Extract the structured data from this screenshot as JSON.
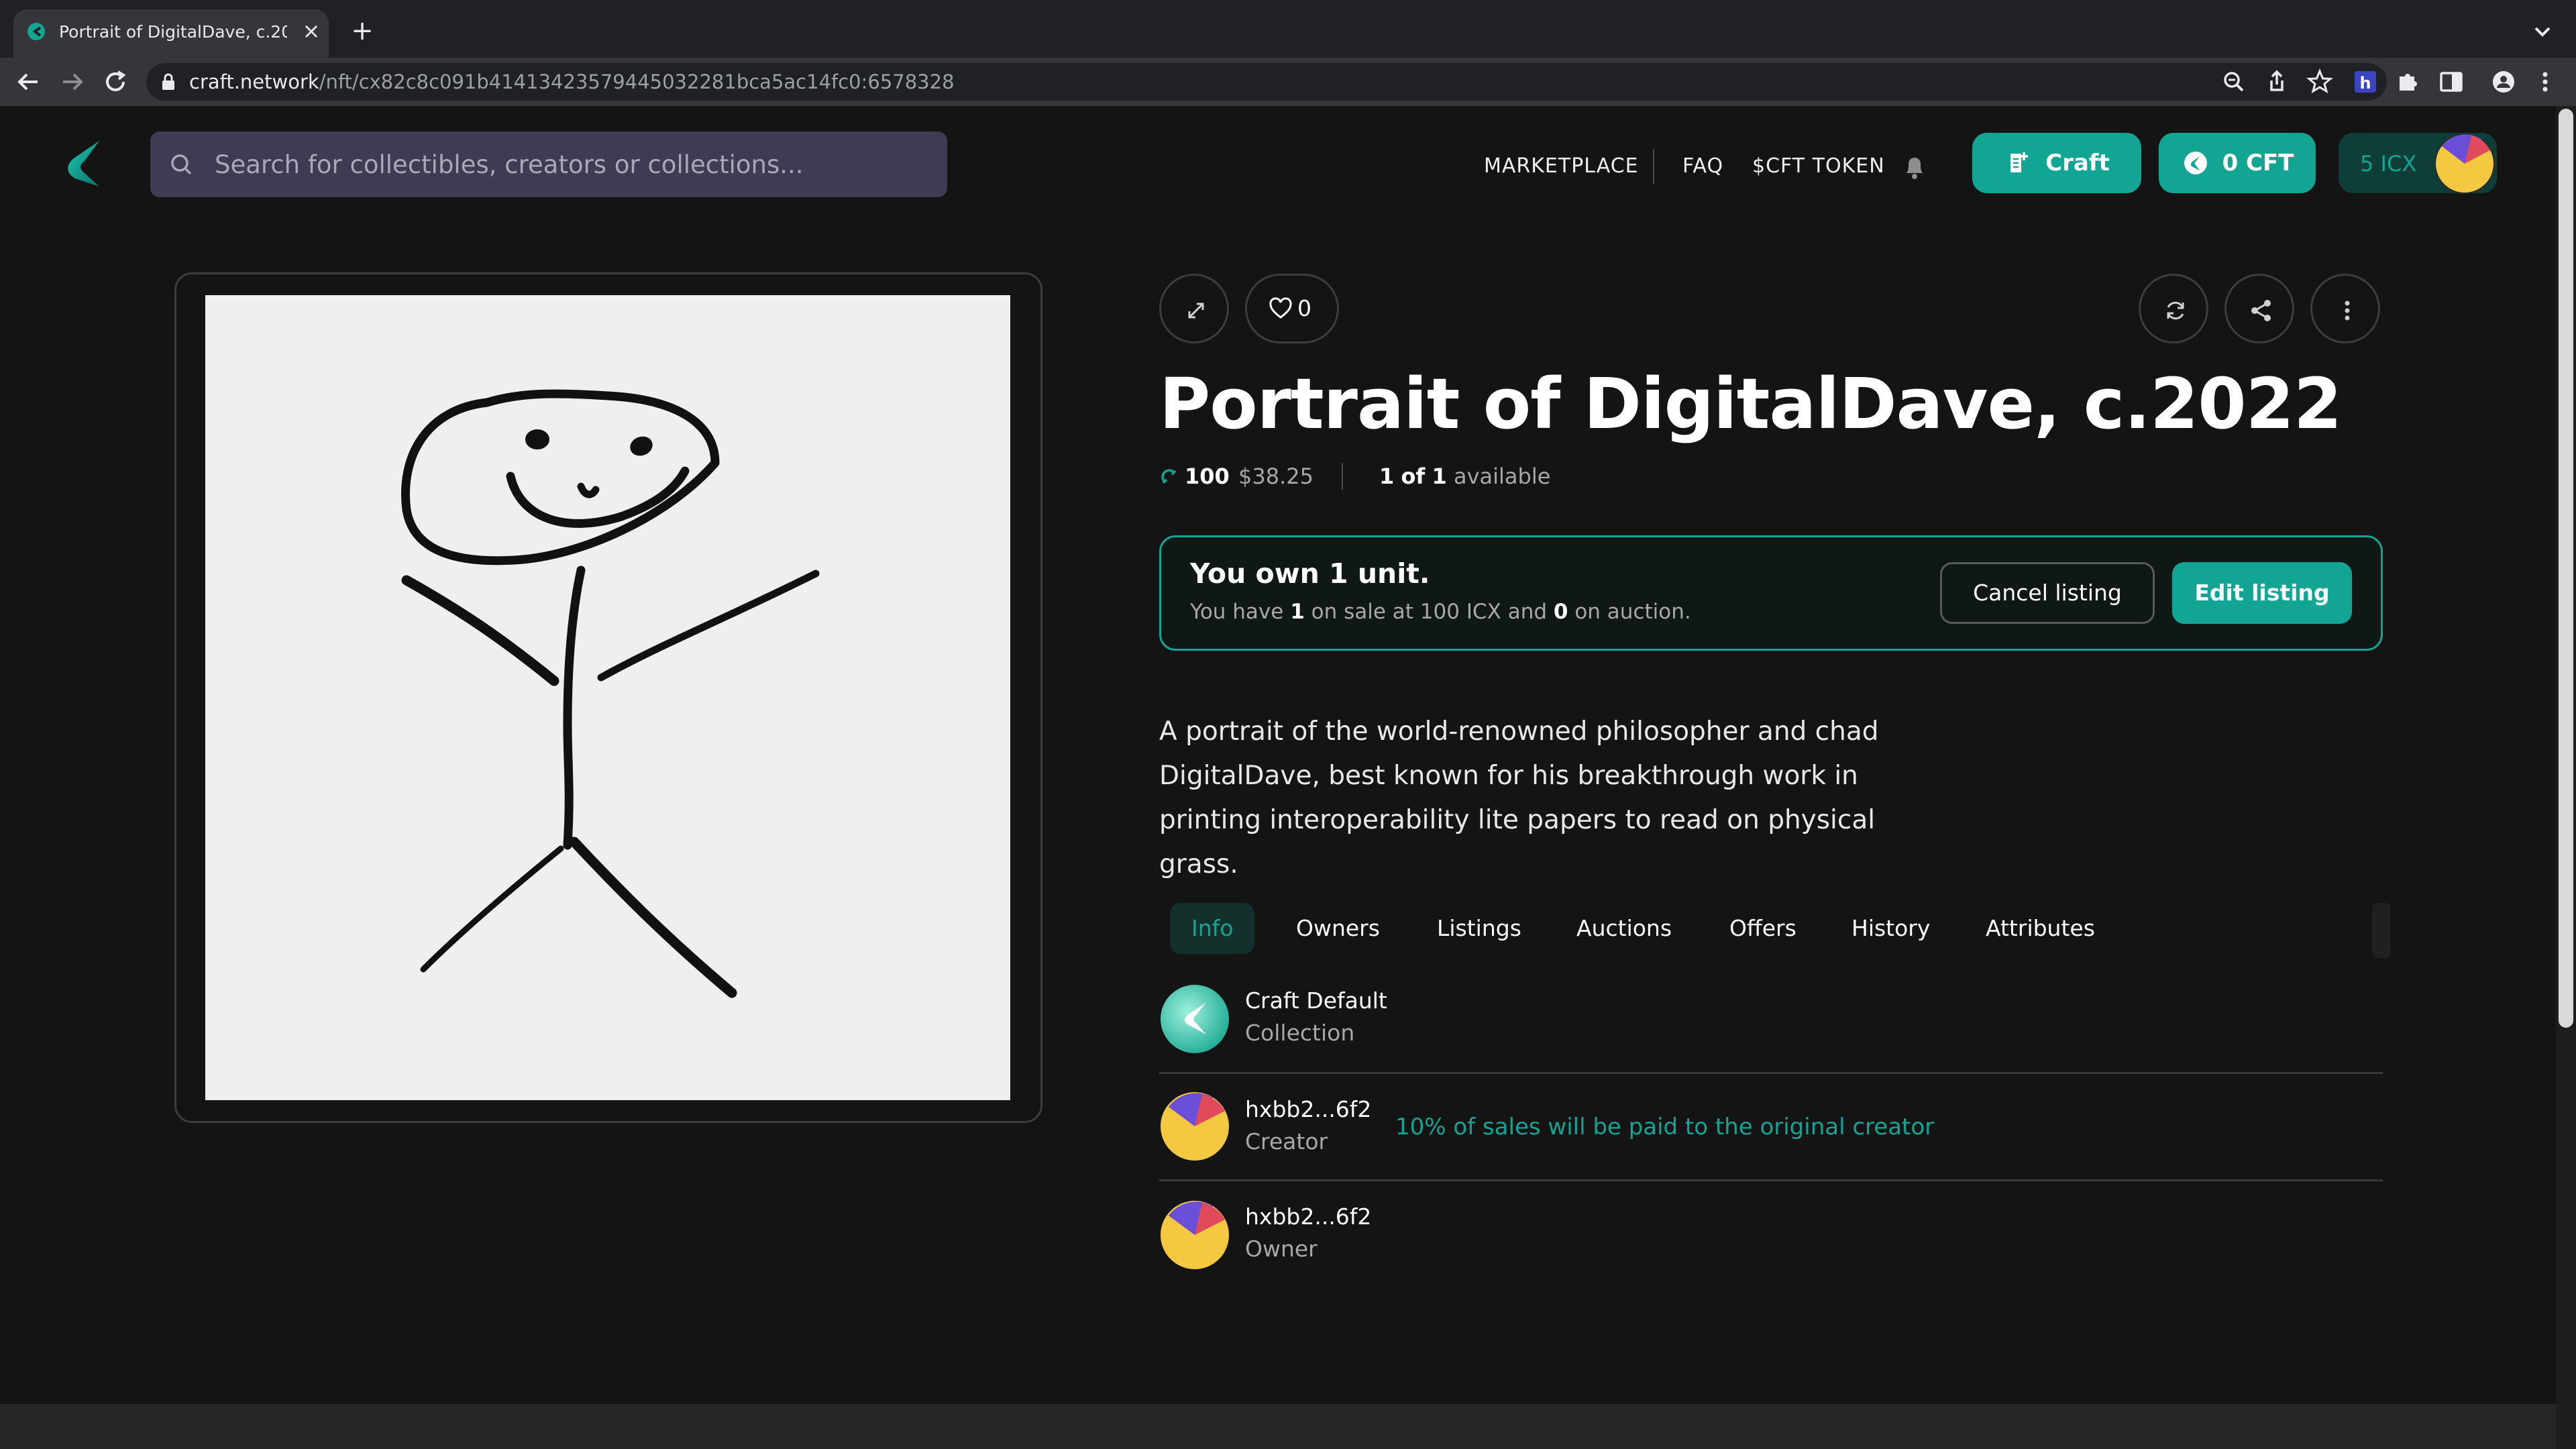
{
  "browser": {
    "tab_title": "Portrait of DigitalDave, c.2022",
    "url_host": "craft.network",
    "url_path": "/nft/cx82c8c091b41413423579445032281bca5ac14fc0:6578328"
  },
  "header": {
    "search_placeholder": "Search for collectibles, creators or collections...",
    "nav": {
      "marketplace": "MARKETPLACE",
      "faq": "FAQ",
      "token": "$CFT TOKEN"
    },
    "craft_button": "Craft",
    "cft_balance": "0 CFT",
    "icx_balance": "5 ICX"
  },
  "item": {
    "likes": "0",
    "title": "Portrait of DigitalDave, c.2022",
    "price_icx": "100",
    "price_usd": "$38.25",
    "availability": {
      "owned": "1",
      "of": "of",
      "total": "1",
      "suffix": "available"
    },
    "ownership": {
      "title": "You own 1 unit.",
      "sub_prefix": "You have",
      "on_sale_count": "1",
      "sub_mid": "on sale at 100 ICX and",
      "auction_count": "0",
      "sub_suffix": "on auction."
    },
    "cancel_listing": "Cancel listing",
    "edit_listing": "Edit listing",
    "description": "A portrait of the world-renowned philosopher and chad DigitalDave, best known for his breakthrough work in printing interoperability lite papers to read on physical grass."
  },
  "tabs": [
    "Info",
    "Owners",
    "Listings",
    "Auctions",
    "Offers",
    "History",
    "Attributes"
  ],
  "info_rows": [
    {
      "name": "Craft Default",
      "role": "Collection"
    },
    {
      "name": "hxbb2...6f2",
      "role": "Creator",
      "note": "10% of sales will be paid to the original creator"
    },
    {
      "name": "hxbb2...6f2",
      "role": "Owner"
    }
  ],
  "colors": {
    "accent": "#12a594",
    "background": "#141414",
    "search_bg": "#3d3c52"
  }
}
